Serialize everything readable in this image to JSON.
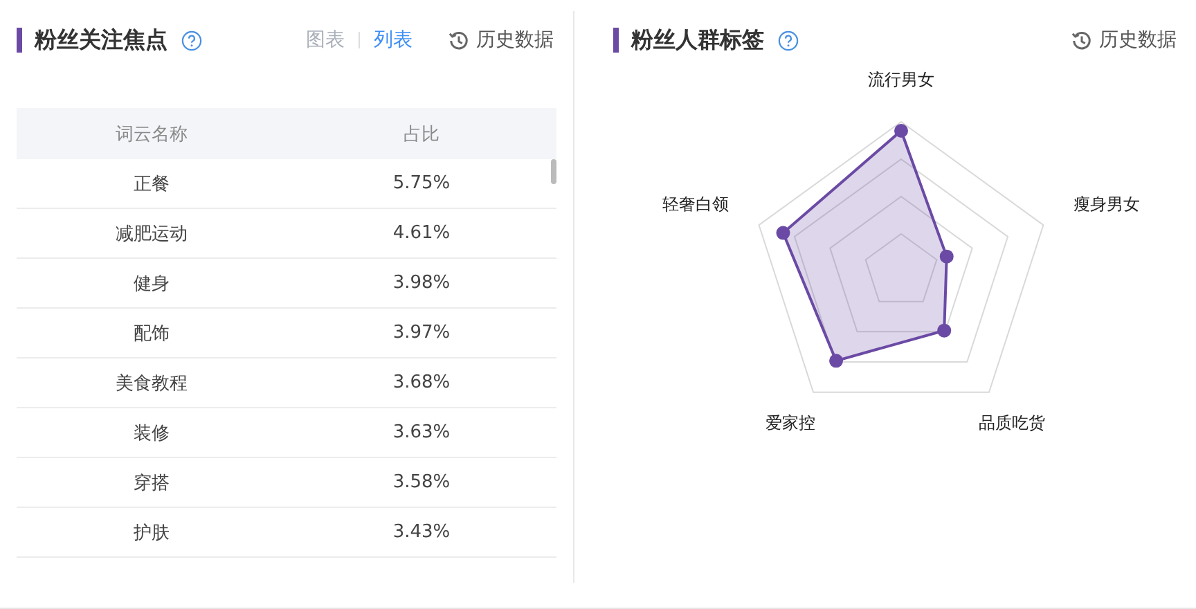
{
  "focus_panel": {
    "title": "粉丝关注焦点",
    "view_tabs": [
      {
        "label": "图表",
        "selected": false
      },
      {
        "label": "列表",
        "selected": true
      }
    ],
    "history_link": "历史数据",
    "table": {
      "columns": [
        "词云名称",
        "占比"
      ],
      "rows": [
        {
          "name": "正餐",
          "share": "5.75%"
        },
        {
          "name": "减肥运动",
          "share": "4.61%"
        },
        {
          "name": "健身",
          "share": "3.98%"
        },
        {
          "name": "配饰",
          "share": "3.97%"
        },
        {
          "name": "美食教程",
          "share": "3.68%"
        },
        {
          "name": "装修",
          "share": "3.63%"
        },
        {
          "name": "穿搭",
          "share": "3.58%"
        },
        {
          "name": "护肤",
          "share": "3.43%"
        }
      ]
    }
  },
  "tags_panel": {
    "title": "粉丝人群标签",
    "history_link": "历史数据",
    "radar_labels": [
      "流行男女",
      "瘦身男女",
      "品质吃货",
      "爱家控",
      "轻奢白领"
    ]
  }
}
